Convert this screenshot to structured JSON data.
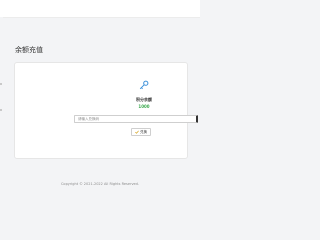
{
  "page": {
    "title": "余额充值"
  },
  "balance": {
    "label": "积分余额",
    "value": "1000"
  },
  "redeem": {
    "placeholder": "请输入兑换码",
    "button_label": "兑换",
    "icon": "check-icon"
  },
  "footer": {
    "text": "Copyright © 2021-2022 All Rights Reserved."
  },
  "colors": {
    "accent": "#3aa84d",
    "icon": "#3a8fd9"
  }
}
